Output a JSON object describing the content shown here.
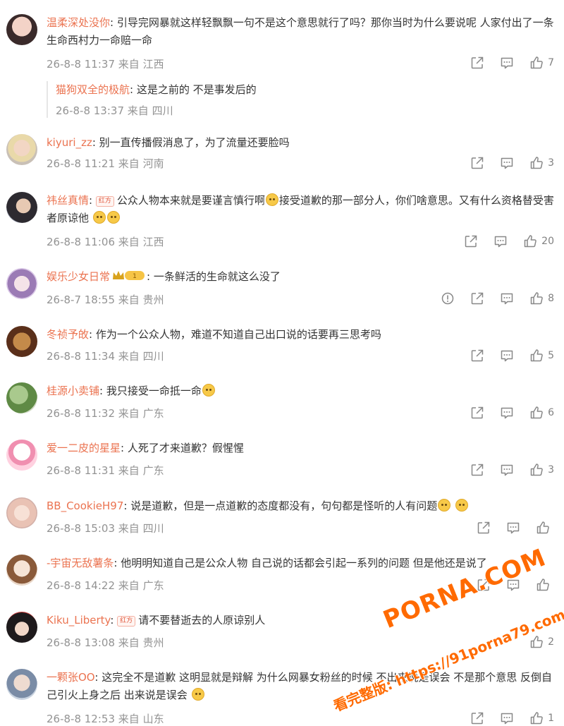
{
  "comments": [
    {
      "username": "温柔深处没你",
      "content": "引导完网暴就这样轻飘飘一句不是这个意思就行了吗？那你当时为什么要说呢 人家付出了一条生命西村力一命赔一命",
      "time": "26-8-8 11:37",
      "source_prefix": "来自",
      "location": "江西",
      "likes": "7",
      "reply": {
        "username": "猫狗双全的极航",
        "content": "这是之前的 不是事发后的",
        "time": "26-8-8 13:37",
        "source_prefix": "来自",
        "location": "四川"
      }
    },
    {
      "username": "kiyuri_zz",
      "content": "别一直传播假消息了，为了流量还要脸吗",
      "time": "26-8-8 11:21",
      "source_prefix": "来自",
      "location": "河南",
      "likes": "3"
    },
    {
      "username": "祎丝真情",
      "badge": "红方",
      "content_a": "公众人物本来就是要谨言慎行啊",
      "content_b": "接受道歉的那一部分人，你们啥意思。又有什么资格替受害者原谅他",
      "time": "26-8-8 11:06",
      "source_prefix": "来自",
      "location": "江西",
      "likes": "20"
    },
    {
      "username": "娱乐少女日常",
      "vip_level": "1",
      "content": "一条鲜活的生命就这么没了",
      "time": "26-8-7 18:55",
      "source_prefix": "来自",
      "location": "贵州",
      "likes": "8"
    },
    {
      "username": "冬祯予敀",
      "content": "作为一个公众人物，难道不知道自己出口说的话要再三思考吗",
      "time": "26-8-8 11:34",
      "source_prefix": "来自",
      "location": "四川",
      "likes": "5"
    },
    {
      "username": "桂源小卖铺",
      "content": "我只接受一命抵一命",
      "time": "26-8-8 11:32",
      "source_prefix": "来自",
      "location": "广东",
      "likes": "6"
    },
    {
      "username": "爱一二皮的星星",
      "content": "人死了才来道歉？假惺惺",
      "time": "26-8-8 11:31",
      "source_prefix": "来自",
      "location": "广东",
      "likes": "3"
    },
    {
      "username": "BB_CookieH97",
      "content": "说是道歉，但是一点道歉的态度都没有，句句都是怪听的人有问题",
      "time": "26-8-8 15:03",
      "source_prefix": "来自",
      "location": "四川",
      "likes": ""
    },
    {
      "username": "-宇宙无敌薯条",
      "content": "他明明知道自己是公众人物 自己说的话都会引起一系列的问题 但是他还是说了",
      "time": "26-8-8 14:22",
      "source_prefix": "来自",
      "location": "广东",
      "likes": ""
    },
    {
      "username": "Kiku_Liberty",
      "badge": "红方",
      "content": "请不要替逝去的人原谅别人",
      "time": "26-8-8 13:08",
      "source_prefix": "来自",
      "location": "贵州",
      "likes": "2"
    },
    {
      "username": "一颗张OO",
      "content": "这完全不是道歉 这明显就是辩解 为什么网暴女粉丝的时候 不出来说是误会 不是那个意思 反倒自己引火上身之后 出来说是误会",
      "time": "26-8-8 12:53",
      "source_prefix": "来自",
      "location": "山东",
      "likes": "1"
    }
  ],
  "watermark": {
    "brand": "PORNA.COM",
    "line": "看完整版: https://91porna79.com"
  },
  "colors": {
    "username": "#eb7350",
    "meta": "#939393",
    "icon": "#808080"
  },
  "icons": {
    "share": "share-icon",
    "comment": "comment-icon",
    "like": "thumbs-up-icon",
    "report": "report-icon"
  }
}
